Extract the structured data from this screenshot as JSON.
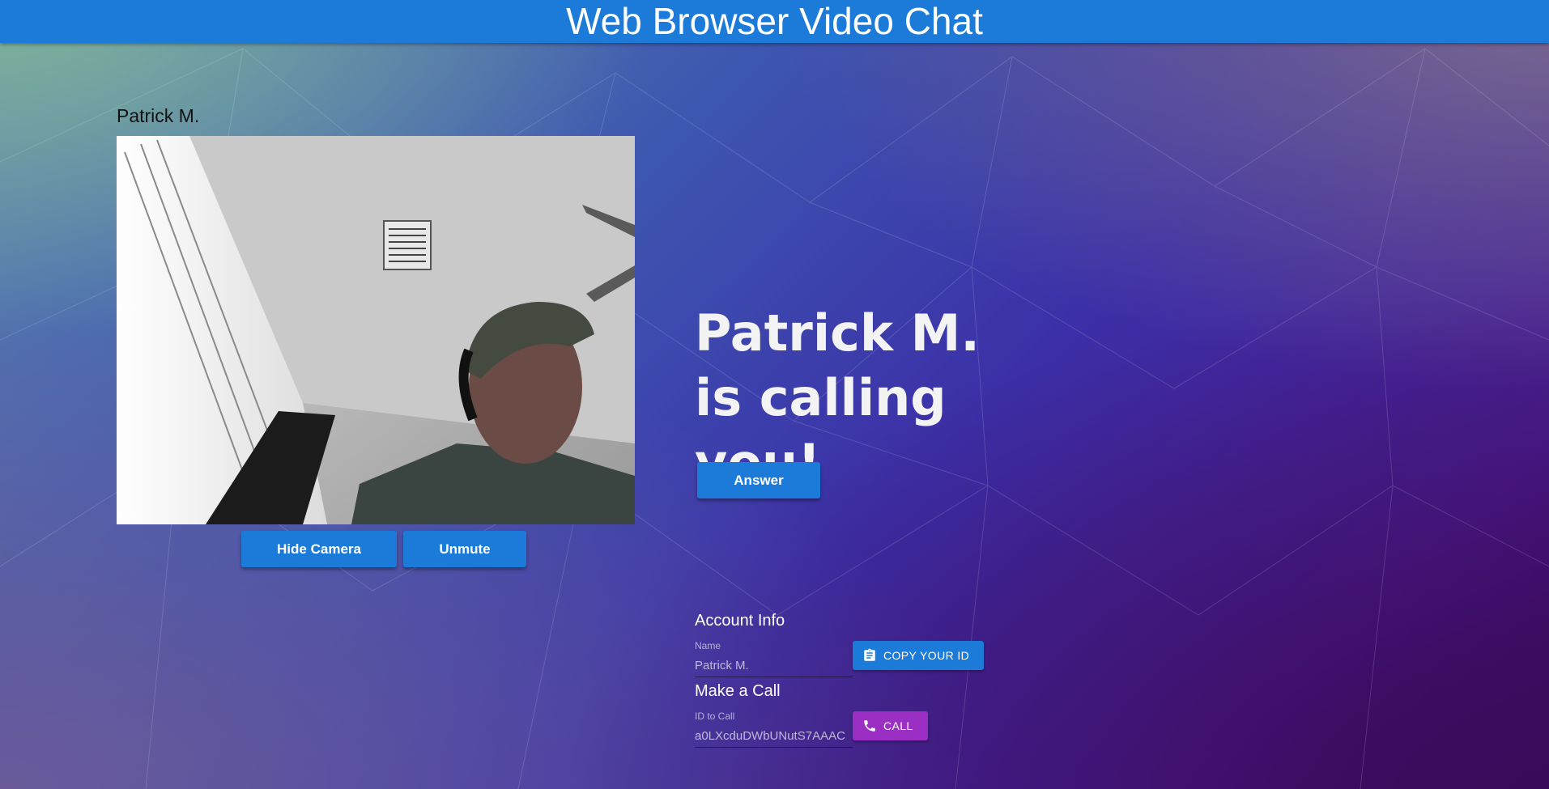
{
  "header": {
    "title": "Web Browser Video Chat"
  },
  "local_video": {
    "label": "Patrick M.",
    "hide_camera_label": "Hide Camera",
    "unmute_label": "Unmute"
  },
  "incoming_call": {
    "message": "Patrick M. is calling you!",
    "answer_label": "Answer"
  },
  "account": {
    "title": "Account Info",
    "name_label": "Name",
    "name_value": "Patrick M.",
    "copy_label": "COPY YOUR ID",
    "copy_icon": "clipboard-icon"
  },
  "make_call": {
    "title": "Make a Call",
    "id_label": "ID to Call",
    "id_value": "a0LXcduDWbUNutS7AAAC",
    "call_label": "CALL",
    "call_icon": "phone-icon"
  },
  "colors": {
    "primary": "#1c7bd8",
    "call_button": "#9b2fc4"
  }
}
